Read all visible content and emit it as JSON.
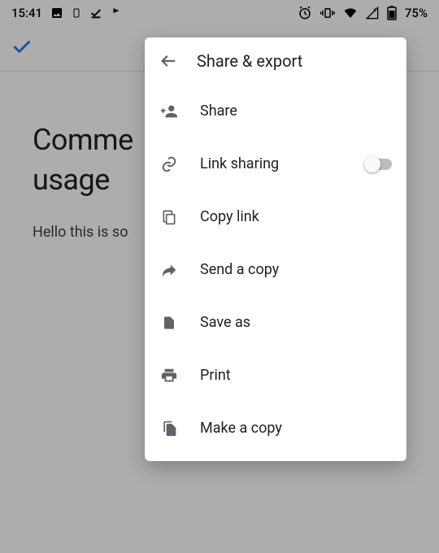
{
  "status_bar": {
    "time": "15:41",
    "battery_pct": "75%"
  },
  "document": {
    "title_line1": "Comme",
    "title_line2": "usage",
    "body_visible": "Hello this is so"
  },
  "panel": {
    "title": "Share & export",
    "items": [
      {
        "id": "share",
        "label": "Share"
      },
      {
        "id": "link-sharing",
        "label": "Link sharing",
        "toggle": false
      },
      {
        "id": "copy-link",
        "label": "Copy link"
      },
      {
        "id": "send-copy",
        "label": "Send a copy"
      },
      {
        "id": "save-as",
        "label": "Save as"
      },
      {
        "id": "print",
        "label": "Print"
      },
      {
        "id": "make-copy",
        "label": "Make a copy"
      }
    ]
  }
}
